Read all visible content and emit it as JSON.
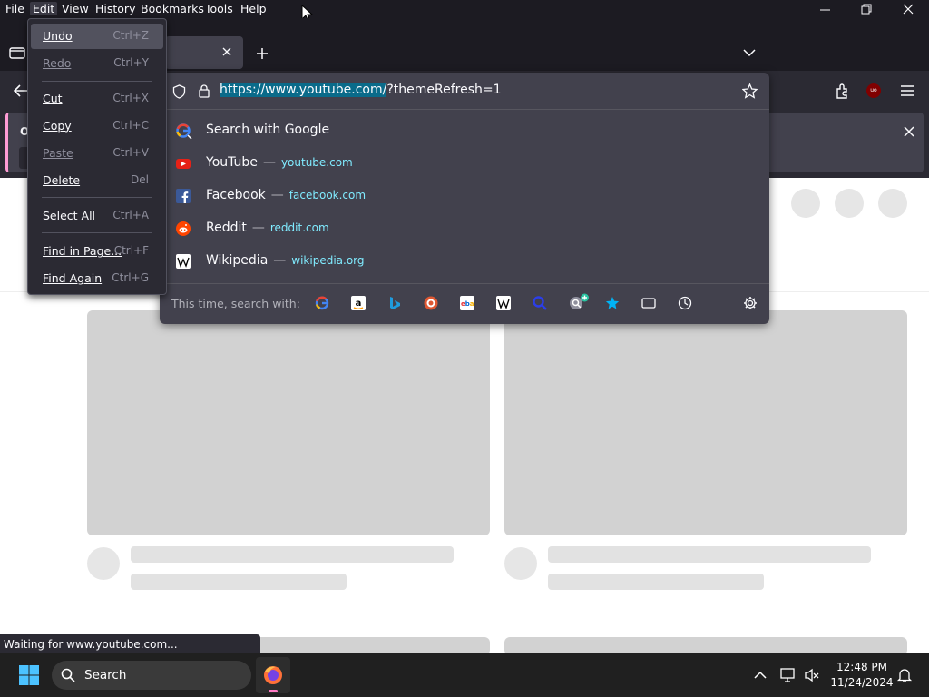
{
  "menubar": {
    "file": "File",
    "edit": "Edit",
    "view": "View",
    "history": "History",
    "bookmarks": "Bookmarks",
    "tools": "Tools",
    "help": "Help"
  },
  "notification": {
    "text": "Op"
  },
  "urlbar": {
    "url_highlighted": "https://www.youtube.com/",
    "url_rest": "?themeRefresh=1"
  },
  "suggestions": [
    {
      "title": "Search with Google",
      "url": "",
      "icon": "google-icon"
    },
    {
      "title": "YouTube",
      "url": "youtube.com",
      "icon": "youtube-icon"
    },
    {
      "title": "Facebook",
      "url": "facebook.com",
      "icon": "facebook-icon"
    },
    {
      "title": "Reddit",
      "url": "reddit.com",
      "icon": "reddit-icon"
    },
    {
      "title": "Wikipedia",
      "url": "wikipedia.org",
      "icon": "wikipedia-icon"
    }
  ],
  "search_with": {
    "label": "This time, search with:",
    "engines": [
      "google",
      "amazon",
      "bing",
      "duckduckgo",
      "ebay",
      "wikipedia",
      "search",
      "add-engine",
      "bookmarks",
      "tabs",
      "history"
    ]
  },
  "edit_menu": [
    {
      "label": "Undo",
      "shortcut": "Ctrl+Z",
      "enabled": true,
      "highlighted": true
    },
    {
      "label": "Redo",
      "shortcut": "Ctrl+Y",
      "enabled": false
    },
    {
      "label": "Cut",
      "shortcut": "Ctrl+X",
      "enabled": false
    },
    {
      "label": "Copy",
      "shortcut": "Ctrl+C",
      "enabled": true
    },
    {
      "label": "Paste",
      "shortcut": "Ctrl+V",
      "enabled": false
    },
    {
      "label": "Delete",
      "shortcut": "Del",
      "enabled": true
    },
    {
      "label": "Select All",
      "shortcut": "Ctrl+A",
      "enabled": true
    },
    {
      "label": "Find in Page...",
      "shortcut": "Ctrl+F",
      "enabled": true
    },
    {
      "label": "Find Again",
      "shortcut": "Ctrl+G",
      "enabled": true
    }
  ],
  "status": {
    "text": "Waiting for www.youtube.com..."
  },
  "taskbar": {
    "search_placeholder": "Search",
    "time": "12:48 PM",
    "date": "11/24/2024"
  },
  "extensions": {
    "ublock_label": "uo"
  },
  "colors": {
    "accent": "#80ebff",
    "menu_bg": "#2b2a33",
    "panel_bg": "#42414d",
    "taskbar_bg": "#202020"
  }
}
